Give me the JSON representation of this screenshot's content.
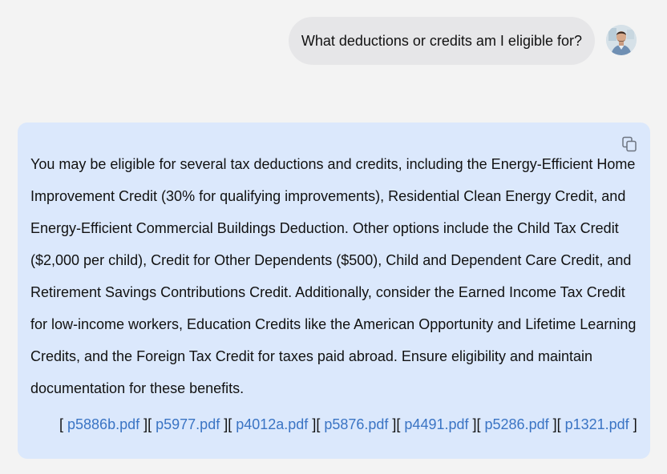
{
  "conversation": {
    "user_message": "What deductions or credits am I eligible for?",
    "user_avatar_icon": "user-avatar-photo",
    "assistant_message": "You may be eligible for several tax deductions and credits, including the Energy-Efficient Home Improvement Credit (30% for qualifying improvements), Residential Clean Energy Credit, and Energy-Efficient Commercial Buildings Deduction. Other options include the Child Tax Credit ($2,000 per child), Credit for Other Dependents ($500), Child and Dependent Care Credit, and Retirement Savings Contributions Credit. Additionally, consider the Earned Income Tax Credit for low-income workers, Education Credits like the American Opportunity and Lifetime Learning Credits, and the Foreign Tax Credit for taxes paid abroad. Ensure eligibility and maintain documentation for these benefits.",
    "copy_icon": "copy-icon",
    "sources": {
      "open": "[",
      "separator": "][",
      "close": "]",
      "files": [
        "p5886b.pdf",
        "p5977.pdf",
        "p4012a.pdf",
        "p5876.pdf",
        "p4491.pdf",
        "p5286.pdf",
        "p1321.pdf"
      ]
    }
  },
  "colors": {
    "page_background": "#f3f3f3",
    "user_bubble": "#e6e6e8",
    "assistant_card": "#dbe8fc",
    "link": "#3a74c4"
  }
}
